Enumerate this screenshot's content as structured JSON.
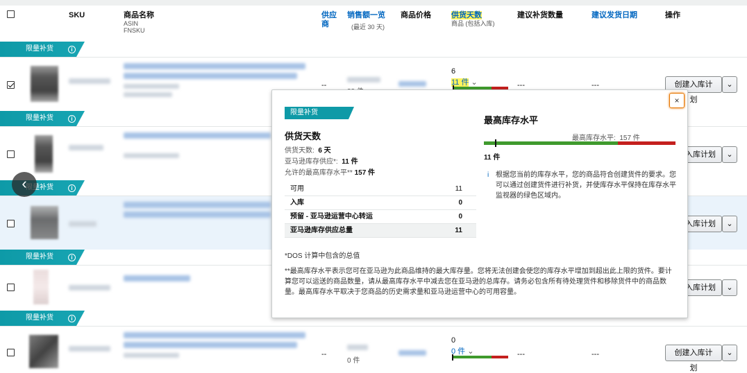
{
  "header": {
    "sku": "SKU",
    "product_name": "商品名称",
    "asin": "ASIN",
    "fnsku": "FNSKU",
    "supply": "供应商",
    "sales": "销售额一览",
    "sales_sub": "(最近 30 天)",
    "price": "商品价格",
    "days_supply": "供货天数",
    "days_sub": "商品 (包括入库)",
    "suggest_qty": "建议补货数量",
    "ship_date": "建议发货日期",
    "actions": "操作"
  },
  "banner_label": "限量补货",
  "info_glyph": "i",
  "rows": [
    {
      "days_top": "6",
      "days_units": "11 件",
      "action": "创建入库计划",
      "supply": "--",
      "qty": "---",
      "date": "---",
      "sales_units": "88 件"
    },
    {
      "action": "入库计划"
    },
    {
      "action": "入库计划"
    },
    {
      "action": "入库计划"
    },
    {
      "days_top": "0",
      "days_units": "0 件",
      "action": "创建入库计划",
      "supply": "--",
      "qty": "---",
      "date": "---",
      "sales_units": "0 件"
    }
  ],
  "dropdown_glyph": "⌄",
  "popover": {
    "badge": "限量补货",
    "title": "供货天数",
    "days_label": "供货天数:",
    "days_value": "6 天",
    "supply_label": "亚马逊库存供应*:",
    "supply_value": "11 件",
    "max_label": "允许的最高库存水平**",
    "max_value": "157 件",
    "table": [
      {
        "label": "可用",
        "value": "11"
      },
      {
        "label": "入库",
        "value": "0"
      },
      {
        "label": "预留 - 亚马逊运营中心转运",
        "value": "0"
      },
      {
        "label": "亚马逊库存供应总量",
        "value": "11"
      }
    ],
    "note1": "*DOS 计算中包含的总值",
    "note2": "**最高库存水平表示您可在亚马逊为此商品维持的最大库存量。您将无法创建会使您的库存水平增加到超出此上限的货件。要计算您可以运送的商品数量，请从最高库存水平中减去您在亚马逊的总库存。请务必包含所有待处理货件和移除货件中的商品数量。最高库存水平取决于您商品的历史需求量和亚马逊运营中心的可用容量。",
    "right_title": "最高库存水平",
    "max_bar_label": "最高库存水平:",
    "max_bar_value": "157 件",
    "current_label": "11 件",
    "info_text": "根据您当前的库存水平，您的商品符合创建货件的要求。您可以通过创建货件进行补货，并使库存水平保持在库存水平监视器的绿色区域内。",
    "close": "×"
  },
  "nav_prev": "‹",
  "colors": {
    "teal": "#0e9aa7",
    "green": "#3f9a2d",
    "red": "#c4201e",
    "link": "#0066c0",
    "highlight": "#fff35c"
  },
  "inventory_level": {
    "current": 11,
    "max": 157
  }
}
